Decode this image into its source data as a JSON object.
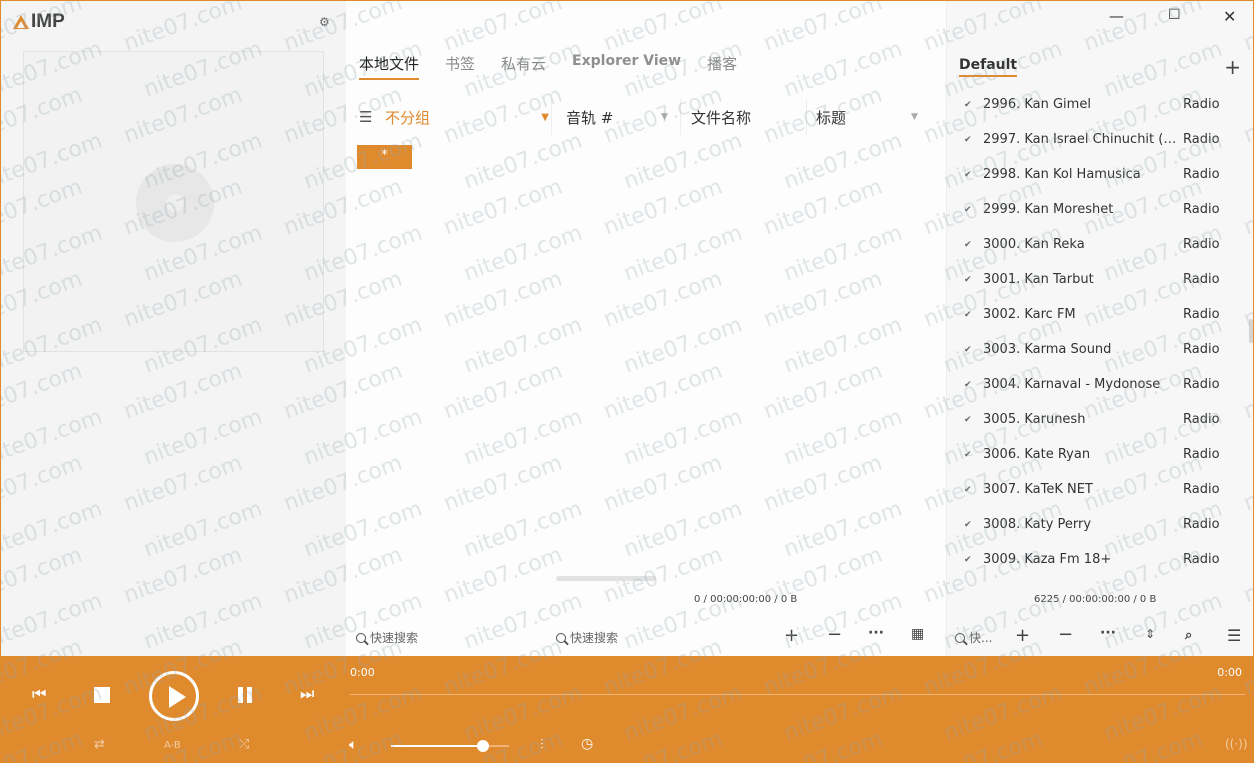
{
  "app": {
    "logo_text": "IMP",
    "accent_color": "#e08a2e"
  },
  "tabs": [
    {
      "label": "本地文件",
      "active": true
    },
    {
      "label": "书签",
      "active": false
    },
    {
      "label": "私有云",
      "active": false
    },
    {
      "label": "Explorer View",
      "active": false
    },
    {
      "label": "播客",
      "active": false
    }
  ],
  "group": {
    "label": "不分组",
    "item": "*"
  },
  "columns": [
    {
      "label": "音轨 #"
    },
    {
      "label": "文件名称"
    },
    {
      "label": "标题"
    }
  ],
  "mid_status": "0 / 00:00:00:00 / 0 B",
  "search": {
    "group_placeholder": "快速搜索",
    "files_placeholder": "快速搜索",
    "playlist_placeholder": "快..."
  },
  "playlist": {
    "title": "Default",
    "items": [
      {
        "name": "2996. Kan Gimel",
        "category": "Radio"
      },
      {
        "name": "2997. Kan Israel Chinuchit (Ed...",
        "category": "Radio"
      },
      {
        "name": "2998. Kan Kol Hamusica",
        "category": "Radio"
      },
      {
        "name": "2999. Kan Moreshet",
        "category": "Radio"
      },
      {
        "name": "3000. Kan Reka",
        "category": "Radio"
      },
      {
        "name": "3001. Kan Tarbut",
        "category": "Radio"
      },
      {
        "name": "3002. Karc FM",
        "category": "Radio"
      },
      {
        "name": "3003. Karma Sound",
        "category": "Radio"
      },
      {
        "name": "3004. Karnaval - Mydonose",
        "category": "Radio"
      },
      {
        "name": "3005. Karunesh",
        "category": "Radio"
      },
      {
        "name": "3006. Kate Ryan",
        "category": "Radio"
      },
      {
        "name": "3007. KaTeK NET",
        "category": "Radio"
      },
      {
        "name": "3008. Katy Perry",
        "category": "Radio"
      },
      {
        "name": "3009. Kaza Fm 18+",
        "category": "Radio"
      }
    ],
    "status": "6225 / 00:00:00:00 / 0 B"
  },
  "player": {
    "time_elapsed": "0:00",
    "time_total": "0:00",
    "ab_label": "A-B",
    "volume_fraction": 0.78
  },
  "watermark": "nite07.com"
}
